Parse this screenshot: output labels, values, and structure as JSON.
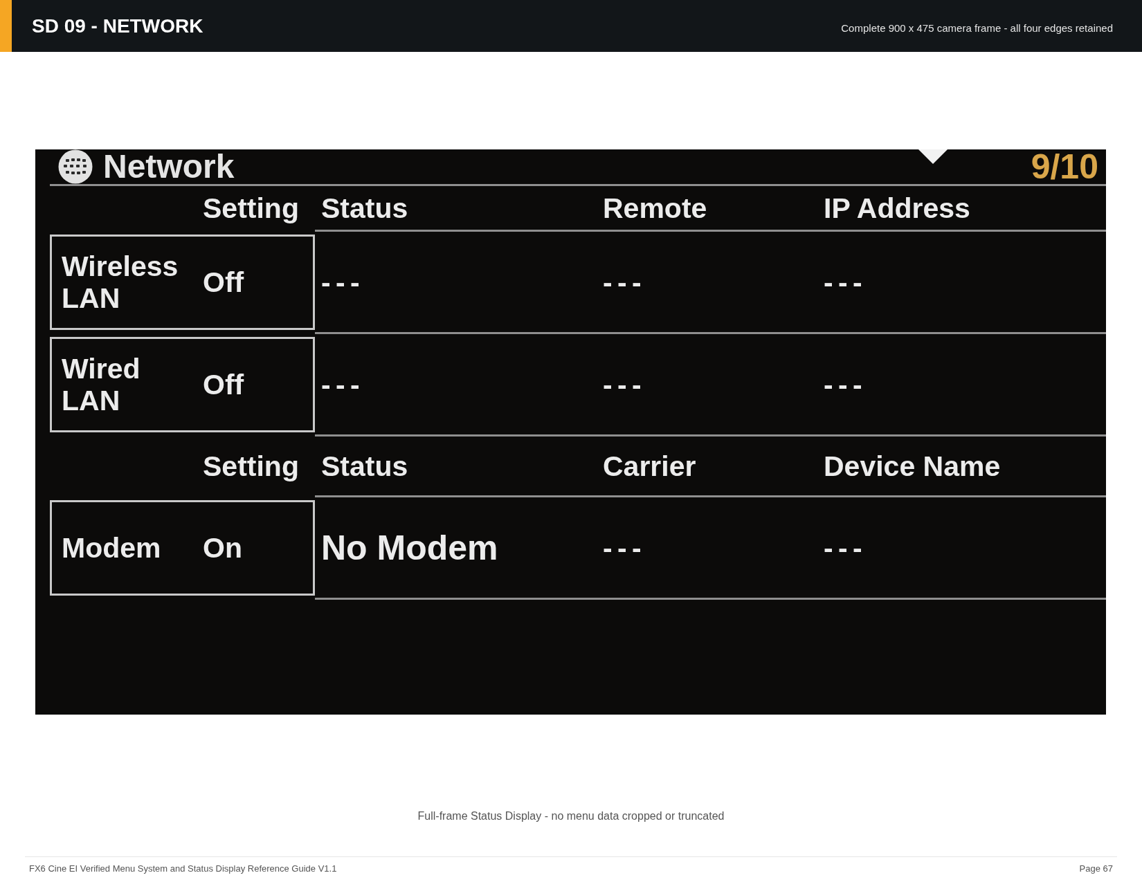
{
  "header": {
    "title": "SD 09 - NETWORK",
    "subtitle": "Complete 900 x 475 camera frame - all four edges retained"
  },
  "camera_screen": {
    "title": "Network",
    "page_indicator": "9/10",
    "sections": [
      {
        "columns": [
          "Setting",
          "Status",
          "Remote",
          "IP Address"
        ],
        "rows": [
          {
            "name": "Wireless LAN",
            "cells": [
              {
                "text": "Off",
                "kind": "setting"
              },
              {
                "text": "---",
                "kind": "plain"
              },
              {
                "text": "---",
                "kind": "plain"
              },
              {
                "text": "---",
                "kind": "plain"
              }
            ]
          },
          {
            "name": "Wired LAN",
            "cells": [
              {
                "text": "Off",
                "kind": "setting"
              },
              {
                "text": "---",
                "kind": "plain"
              },
              {
                "text": "---",
                "kind": "plain"
              },
              {
                "text": "---",
                "kind": "plain"
              }
            ]
          }
        ]
      },
      {
        "columns": [
          "Setting",
          "Status",
          "Carrier",
          "Device Name"
        ],
        "rows": [
          {
            "name": "Modem",
            "cells": [
              {
                "text": "On",
                "kind": "setting"
              },
              {
                "text": "No Modem",
                "kind": "notice"
              },
              {
                "text": "---",
                "kind": "plain"
              },
              {
                "text": "---",
                "kind": "plain"
              }
            ]
          }
        ]
      }
    ]
  },
  "caption": "Full-frame Status Display - no menu data cropped or truncated",
  "footer": {
    "text": "FX6 Cine EI Verified Menu System and Status Display Reference Guide V1.1",
    "page": "Page 67"
  }
}
